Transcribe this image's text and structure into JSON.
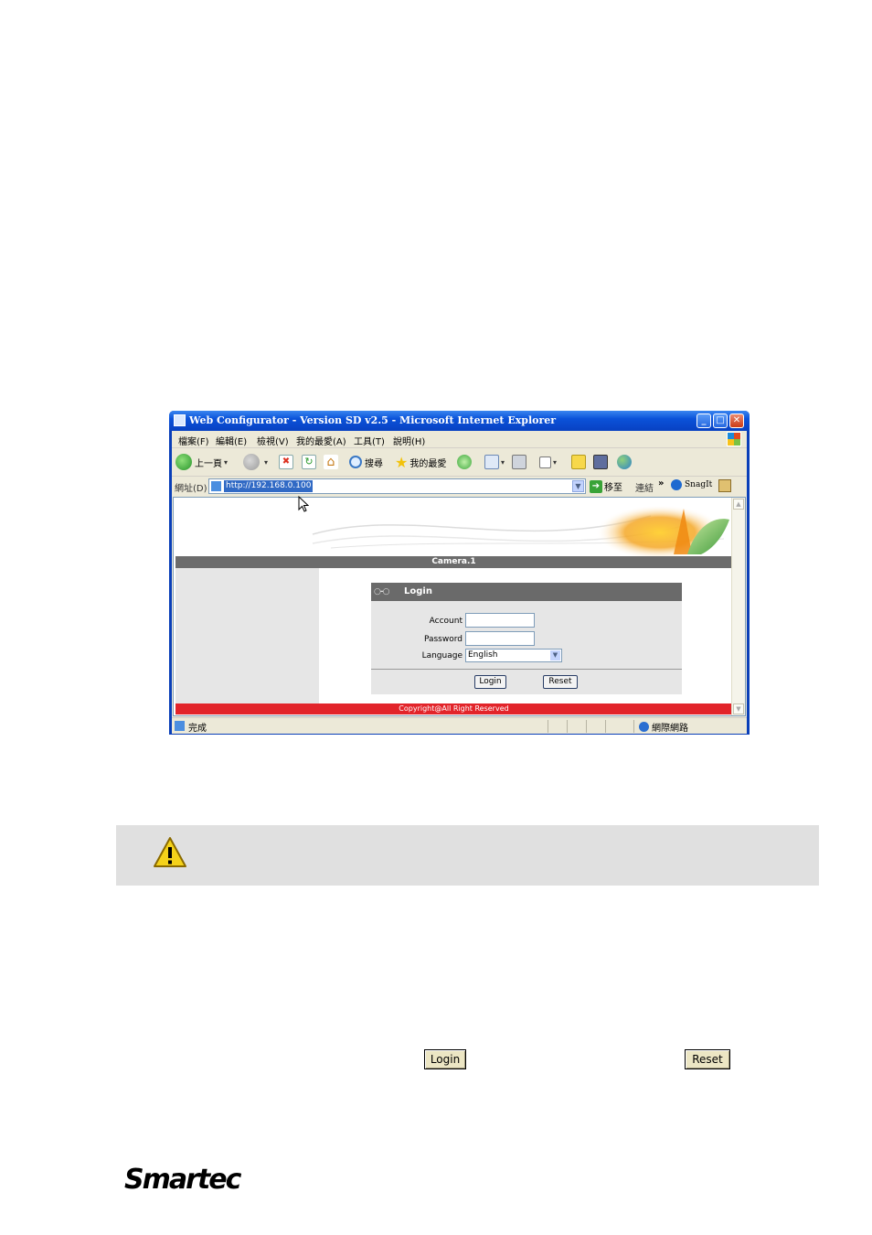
{
  "window": {
    "title": "Web Configurator - Version SD v2.5 - Microsoft Internet Explorer",
    "min": "_",
    "max": "□",
    "close": "✕"
  },
  "menu": [
    "檔案(F)",
    "編輯(E)",
    "檢視(V)",
    "我的最愛(A)",
    "工具(T)",
    "說明(H)"
  ],
  "toolbar": {
    "back": "上一頁",
    "search": "搜尋",
    "favorites": "我的最愛"
  },
  "address": {
    "label": "網址(D)",
    "url": "http://192.168.0.100",
    "go": "移至",
    "links": "連結",
    "more": "»",
    "snagit": "SnagIt"
  },
  "page": {
    "camera_title": "Camera.1",
    "login": {
      "key_glyph": "○-○",
      "title": "Login",
      "account_label": "Account",
      "password_label": "Password",
      "language_label": "Language",
      "language_value": "English",
      "login_button": "Login",
      "reset_button": "Reset"
    },
    "copyright": "Copyright@All Right Reserved"
  },
  "status": {
    "text": "完成",
    "zone": "網際網路"
  },
  "doc": {
    "login_button": "Login",
    "reset_button": "Reset",
    "logo": "Smartec"
  },
  "colors": {
    "title_bar": "#0b52d9",
    "camera_bar": "#6c6c6c",
    "copyright_bar": "#e2242a",
    "caution_bg": "#e0e0e0"
  }
}
